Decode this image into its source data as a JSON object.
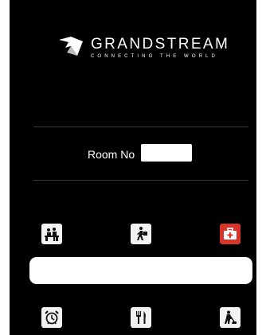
{
  "brand": {
    "name": "GRANDSTREAM",
    "tagline": "CONNECTING THE WORLD"
  },
  "room": {
    "label": "Room No",
    "value": ""
  },
  "services": [
    {
      "id": "reception",
      "icon": "reception-desk-icon"
    },
    {
      "id": "porter",
      "icon": "porter-luggage-icon"
    },
    {
      "id": "medical",
      "icon": "first-aid-kit-icon",
      "color": "#d9342b"
    },
    {
      "id": "wake-up",
      "icon": "alarm-clock-icon"
    },
    {
      "id": "dining",
      "icon": "fork-knife-icon"
    },
    {
      "id": "housekeeping",
      "icon": "housekeeping-cleaning-icon"
    }
  ],
  "message": "",
  "colors": {
    "background": "#000000",
    "button": "#f2f2f2",
    "accent_red": "#d9342b"
  }
}
